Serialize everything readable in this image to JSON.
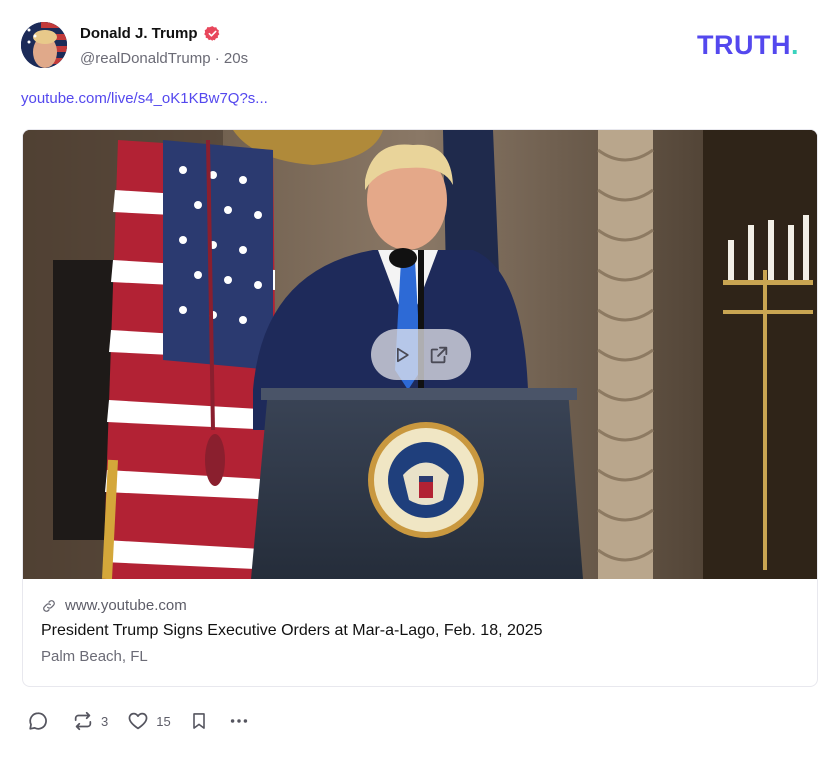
{
  "post": {
    "author_name": "Donald J. Trump",
    "handle": "@realDonaldTrump",
    "separator": "·",
    "time_ago": "20s",
    "link_text": "youtube.com/live/s4_oK1KBw7Q?s..."
  },
  "brand": {
    "logo_text": "TRUTH",
    "logo_dot": ".",
    "accent": "#5448ee",
    "dot_color": "#3ad3be"
  },
  "card": {
    "domain": "www.youtube.com",
    "title": "President Trump Signs Executive Orders at Mar-a-Lago, Feb. 18, 2025",
    "subtitle": "Palm Beach, FL",
    "play_icon": "play-icon",
    "external_icon": "external-link-icon"
  },
  "actions": {
    "reply_icon": "reply-icon",
    "retruth_icon": "retruth-icon",
    "retruth_count": "3",
    "like_icon": "heart-icon",
    "like_count": "15",
    "bookmark_icon": "bookmark-icon",
    "more_icon": "more-icon"
  }
}
